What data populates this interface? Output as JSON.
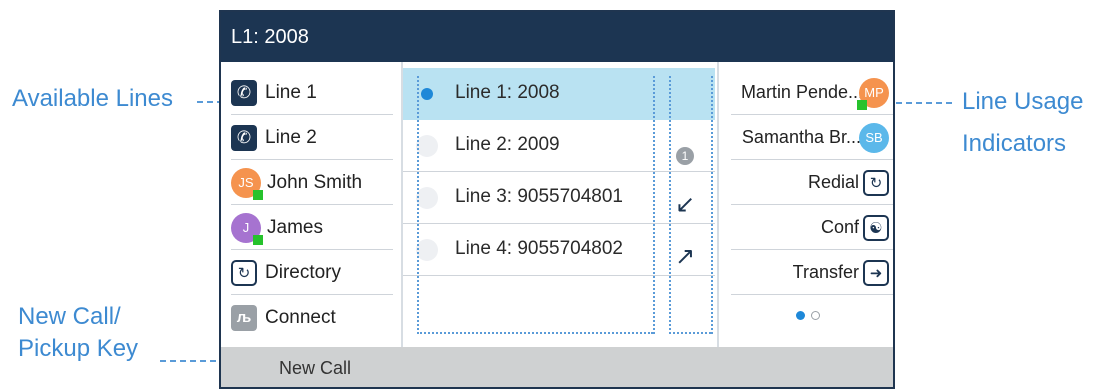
{
  "callouts": {
    "available_lines": "Available Lines",
    "line_usage_1": "Line Usage",
    "line_usage_2": "Indicators",
    "new_call_1": "New Call/",
    "new_call_2": "Pickup Key"
  },
  "screen": {
    "title": "L1: 2008",
    "left_items": [
      {
        "label": "Line 1",
        "icon": "phone-icon"
      },
      {
        "label": "Line 2",
        "icon": "phone-icon"
      },
      {
        "label": "John Smith",
        "icon": "avatar",
        "initials": "JS",
        "color": "#f5934e",
        "presence": "available"
      },
      {
        "label": "James",
        "icon": "avatar",
        "initials": "J",
        "color": "#a673d0",
        "presence": "available"
      },
      {
        "label": "Directory",
        "icon": "directory-icon"
      },
      {
        "label": "Connect",
        "icon": "bluetooth-icon"
      }
    ],
    "lines": [
      {
        "label": "Line 1: 2008",
        "selected": true,
        "indicator": ""
      },
      {
        "label": "Line 2: 2009",
        "selected": false,
        "indicator": "1"
      },
      {
        "label": "Line 3: 9055704801",
        "selected": false,
        "indicator": "incoming-arrow-icon"
      },
      {
        "label": "Line 4: 9055704802",
        "selected": false,
        "indicator": "outgoing-arrow-icon"
      }
    ],
    "right_items": [
      {
        "label": "Martin Pende...",
        "icon": "avatar",
        "initials": "MP",
        "color": "#f5934e",
        "presence": "available"
      },
      {
        "label": "Samantha Br...",
        "icon": "avatar",
        "initials": "SB",
        "color": "#5bb8ea"
      },
      {
        "label": "Redial",
        "icon": "redial-icon"
      },
      {
        "label": "Conf",
        "icon": "conference-icon"
      },
      {
        "label": "Transfer",
        "icon": "transfer-icon"
      }
    ],
    "pager": {
      "current": 1,
      "total": 2
    },
    "bottom_key": "New Call"
  },
  "colors": {
    "title_bar": "#1c3552",
    "selected_row": "#b9e2f2",
    "callout_text": "#3d8ad1",
    "presence_green": "#26c22c",
    "bottom_bar": "#cfd1d2"
  }
}
